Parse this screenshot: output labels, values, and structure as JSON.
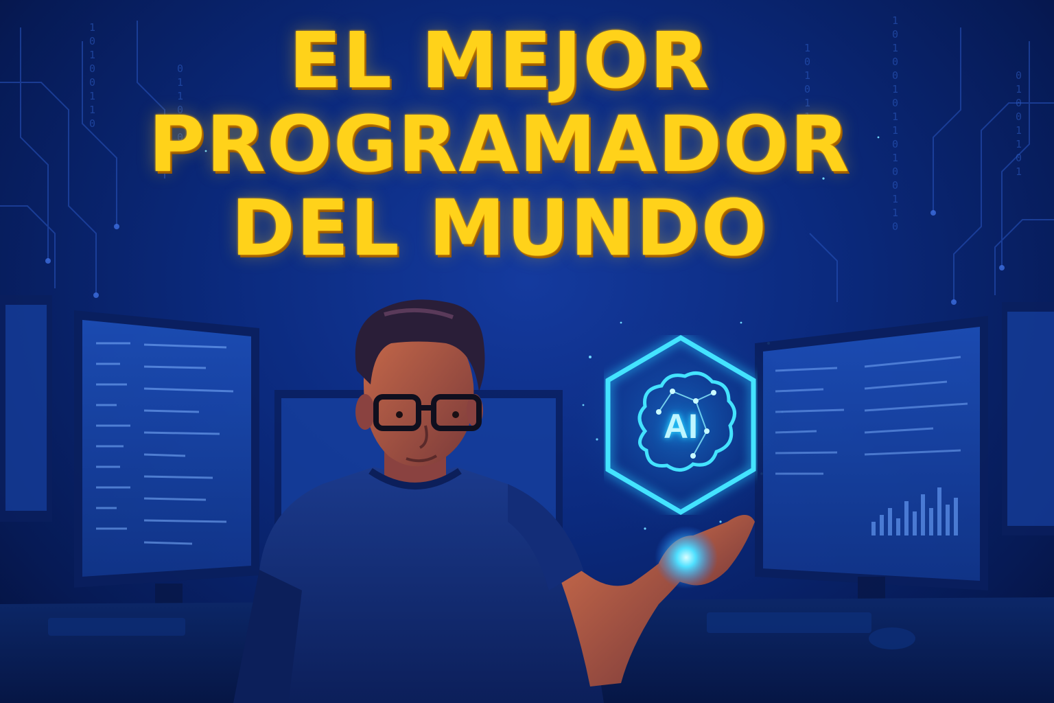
{
  "headline": {
    "line1": "EL MEJOR",
    "line2": "PROGRAMADOR",
    "line3": "DEL MUNDO"
  },
  "ai_badge": {
    "label": "AI"
  },
  "colors": {
    "headline": "#ffd21a",
    "background": "#0b2a7e",
    "ai_glow": "#2fd8ff"
  }
}
